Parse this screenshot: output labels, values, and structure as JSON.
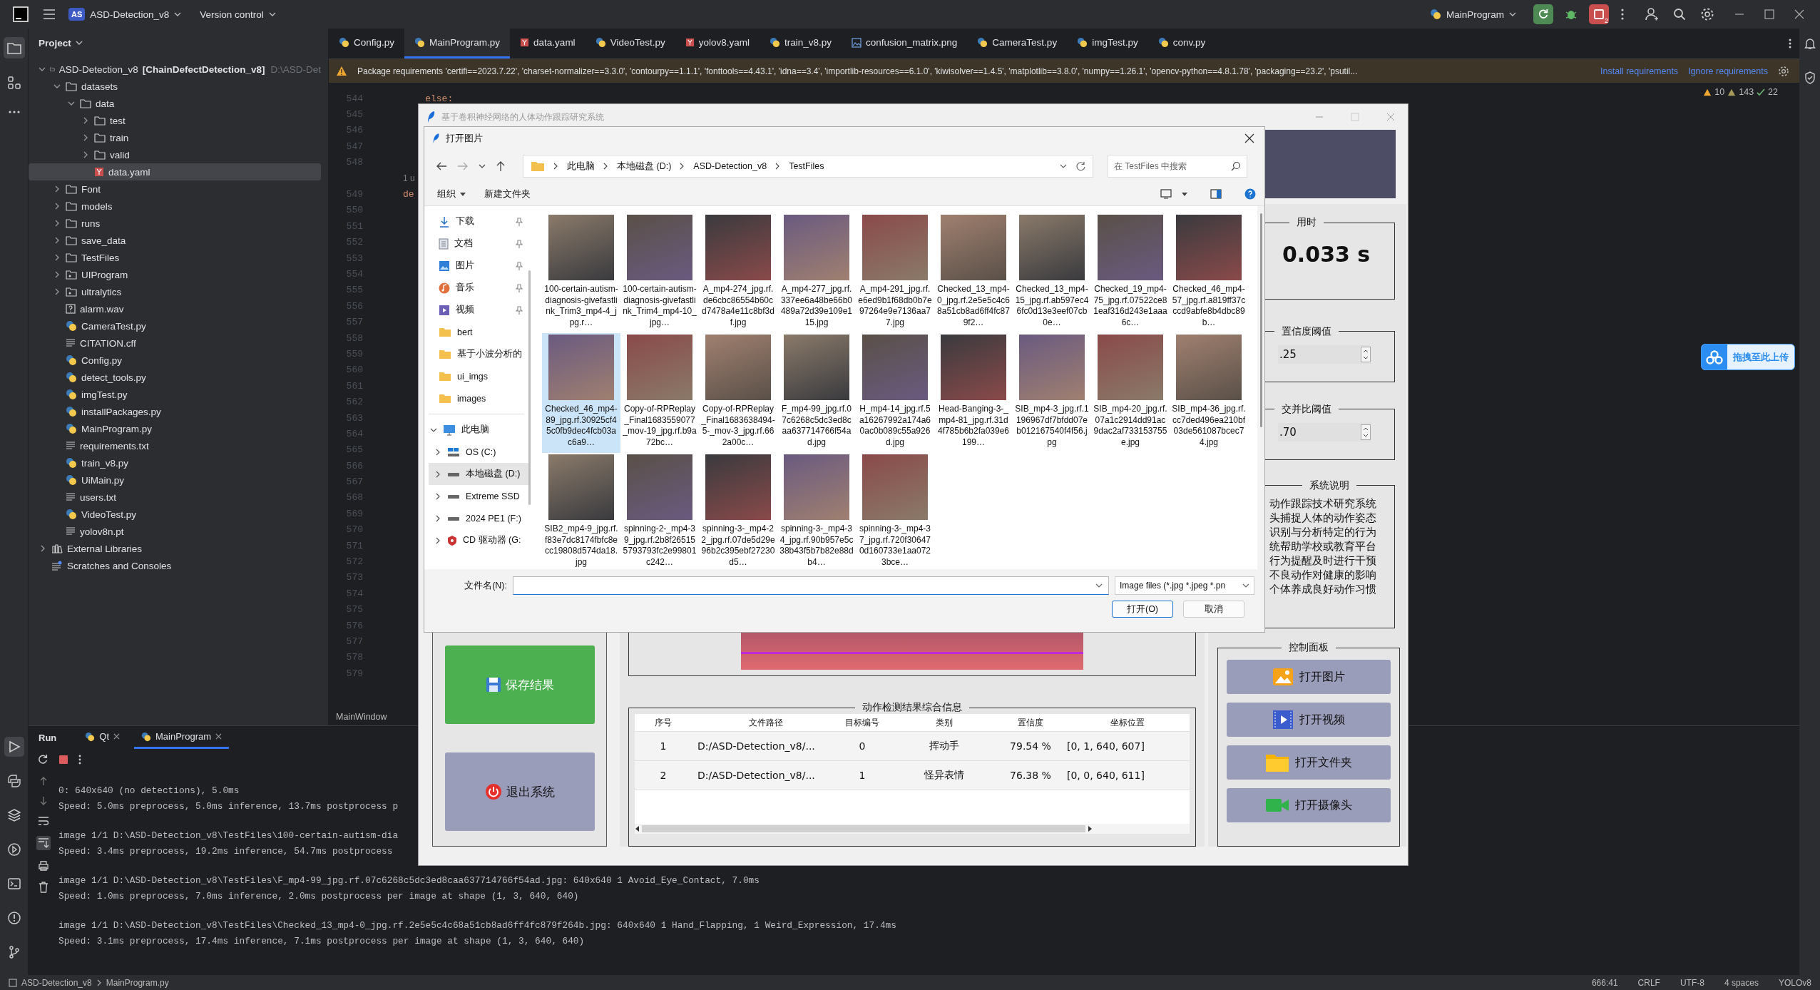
{
  "ide": {
    "project_badge": "AS",
    "project_name": "ASD-Detection_v8",
    "vcs": "Version control",
    "run_config": "MainProgram",
    "stop_badge": "2"
  },
  "project_panel": {
    "title": "Project",
    "tree": [
      {
        "label": "ASD-Detection_v8",
        "module": "[ChainDefectDetection_v8]",
        "path": "D:\\ASD-Det",
        "kind": "folder",
        "expanded": true,
        "selected": false,
        "children": [
          {
            "label": "datasets",
            "kind": "folder",
            "expanded": true,
            "selected": false,
            "children": [
              {
                "label": "data",
                "kind": "folder",
                "expanded": true,
                "selected": false,
                "children": [
                  {
                    "label": "test",
                    "kind": "folder",
                    "expanded": false,
                    "selected": false
                  },
                  {
                    "label": "train",
                    "kind": "folder",
                    "expanded": false,
                    "selected": false
                  },
                  {
                    "label": "valid",
                    "kind": "folder",
                    "expanded": false,
                    "selected": false
                  },
                  {
                    "label": "data.yaml",
                    "kind": "yaml",
                    "selected": true
                  }
                ]
              }
            ]
          },
          {
            "label": "Font",
            "kind": "folder",
            "expanded": false,
            "selected": false
          },
          {
            "label": "models",
            "kind": "folder",
            "expanded": false,
            "selected": false
          },
          {
            "label": "runs",
            "kind": "folder",
            "expanded": false,
            "selected": false
          },
          {
            "label": "save_data",
            "kind": "folder",
            "expanded": false,
            "selected": false
          },
          {
            "label": "TestFiles",
            "kind": "folder",
            "expanded": false,
            "selected": false
          },
          {
            "label": "UIProgram",
            "kind": "package",
            "expanded": false,
            "selected": false
          },
          {
            "label": "ultralytics",
            "kind": "package",
            "expanded": false,
            "selected": false
          },
          {
            "label": "alarm.wav",
            "kind": "unknown",
            "selected": false
          },
          {
            "label": "CameraTest.py",
            "kind": "python",
            "selected": false
          },
          {
            "label": "CITATION.cff",
            "kind": "text",
            "selected": false
          },
          {
            "label": "Config.py",
            "kind": "python",
            "selected": false
          },
          {
            "label": "detect_tools.py",
            "kind": "python",
            "selected": false
          },
          {
            "label": "imgTest.py",
            "kind": "python",
            "selected": false
          },
          {
            "label": "installPackages.py",
            "kind": "python",
            "selected": false
          },
          {
            "label": "MainProgram.py",
            "kind": "python",
            "selected": false
          },
          {
            "label": "requirements.txt",
            "kind": "text",
            "selected": false
          },
          {
            "label": "train_v8.py",
            "kind": "python",
            "selected": false
          },
          {
            "label": "UiMain.py",
            "kind": "python",
            "selected": false
          },
          {
            "label": "users.txt",
            "kind": "text",
            "selected": false
          },
          {
            "label": "VideoTest.py",
            "kind": "python",
            "selected": false
          },
          {
            "label": "yolov8n.pt",
            "kind": "text",
            "selected": false
          }
        ]
      },
      {
        "label": "External Libraries",
        "kind": "library",
        "expanded": false,
        "selected": false
      },
      {
        "label": "Scratches and Consoles",
        "kind": "scratch",
        "selected": false
      }
    ]
  },
  "editor": {
    "tabs": [
      {
        "label": "Config.py",
        "kind": "python",
        "selected": false
      },
      {
        "label": "MainProgram.py",
        "kind": "python",
        "selected": true
      },
      {
        "label": "data.yaml",
        "kind": "yaml",
        "selected": false
      },
      {
        "label": "VideoTest.py",
        "kind": "python",
        "selected": false
      },
      {
        "label": "yolov8.yaml",
        "kind": "yaml",
        "selected": false
      },
      {
        "label": "train_v8.py",
        "kind": "python",
        "selected": false
      },
      {
        "label": "confusion_matrix.png",
        "kind": "image",
        "selected": false
      },
      {
        "label": "CameraTest.py",
        "kind": "python",
        "selected": false
      },
      {
        "label": "imgTest.py",
        "kind": "python",
        "selected": false
      },
      {
        "label": "conv.py",
        "kind": "python",
        "selected": false
      }
    ],
    "banner": {
      "text": "Package requirements 'certifi==2023.7.22', 'charset-normalizer==3.3.0', 'contourpy==1.1.1', 'fonttools==4.43.1', 'idna==3.4', 'importlib-resources==6.1.0', 'kiwisolver==1.4.5', 'matplotlib==3.8.0', 'numpy==1.26.1', 'opencv-python==4.8.1.78', 'packaging==23.2', 'psutil...",
      "actions": [
        "Install requirements",
        "Ignore requirements"
      ]
    },
    "inspections": {
      "warnings": "10",
      "weak_warnings": "143",
      "passed": "22"
    },
    "lines": [
      {
        "number": "544",
        "text": "    else:"
      },
      {
        "number": "545"
      },
      {
        "number": "546"
      },
      {
        "number": "547"
      },
      {
        "number": "548"
      },
      {
        "number": "549",
        "hint": "1 u",
        "text": "de"
      },
      {
        "number": "550"
      },
      {
        "number": "551"
      },
      {
        "number": "552"
      },
      {
        "number": "553"
      },
      {
        "number": "554"
      },
      {
        "number": "555"
      },
      {
        "number": "556"
      },
      {
        "number": "557"
      },
      {
        "number": "558"
      },
      {
        "number": "559"
      },
      {
        "number": "560"
      },
      {
        "number": "561"
      },
      {
        "number": "562"
      },
      {
        "number": "563"
      },
      {
        "number": "564"
      },
      {
        "number": "565"
      },
      {
        "number": "566"
      },
      {
        "number": "567"
      },
      {
        "number": "568"
      },
      {
        "number": "569"
      },
      {
        "number": "570"
      },
      {
        "number": "571"
      },
      {
        "number": "572"
      },
      {
        "number": "573"
      },
      {
        "number": "574"
      },
      {
        "number": "575"
      },
      {
        "number": "576"
      },
      {
        "number": "577"
      },
      {
        "number": "578"
      },
      {
        "number": "579"
      }
    ],
    "breadcrumb": "MainWindow"
  },
  "run_panel": {
    "title": "Run",
    "tabs": [
      {
        "label": "Qt",
        "selected": false
      },
      {
        "label": "MainProgram",
        "selected": true
      }
    ],
    "console": [
      [
        "0: 640x640 (no detections), 5.0ms",
        "Speed: 5.0ms preprocess, 5.0ms inference, 13.7ms postprocess p"
      ],
      [
        "image 1/1 D:\\ASD-Detection_v8\\TestFiles\\100-certain-autism-dia",
        "Speed: 3.4ms preprocess, 19.2ms inference, 54.7ms postprocess"
      ],
      [
        "image 1/1 D:\\ASD-Detection_v8\\TestFiles\\F_mp4-99_jpg.rf.07c6268c5dc3ed8caa637714766f54ad.jpg: 640x640 1 Avoid_Eye_Contact, 7.0ms",
        "Speed: 1.0ms preprocess, 7.0ms inference, 2.0ms postprocess per image at shape (1, 3, 640, 640)"
      ],
      [
        "image 1/1 D:\\ASD-Detection_v8\\TestFiles\\Checked_13_mp4-0_jpg.rf.2e5e5c4c68a51cb8ad6ff4fc879f264b.jpg: 640x640 1 Hand_Flapping, 1 Weird_Expression, 17.4ms",
        "Speed: 3.1ms preprocess, 17.4ms inference, 7.1ms postprocess per image at shape (1, 3, 640, 640)"
      ]
    ]
  },
  "status_bar": {
    "path": [
      "ASD-Detection_v8",
      "MainProgram.py"
    ],
    "items": [
      "666:41",
      "CRLF",
      "UTF-8",
      "4 spaces",
      "YOLOv8"
    ]
  },
  "app_window": {
    "title": "基于卷积神经网络的人体动作跟踪研究系统",
    "left_buttons": [
      {
        "label": "保存结果",
        "kind": "save"
      },
      {
        "label": "退出系统",
        "kind": "exit"
      }
    ],
    "results": {
      "title": "动作检测结果综合信息",
      "columns": [
        "序号",
        "文件路径",
        "目标编号",
        "类别",
        "置信度",
        "坐标位置"
      ],
      "rows": [
        [
          "1",
          "D:/ASD-Detection_v8/...",
          "0",
          "挥动手",
          "79.54 %",
          "[0, 1, 640, 607]"
        ],
        [
          "2",
          "D:/ASD-Detection_v8/...",
          "1",
          "怪异表情",
          "76.38 %",
          "[0, 0, 640, 611]"
        ]
      ]
    },
    "time": {
      "title": "用时",
      "value": "0.033 s"
    },
    "confidence": {
      "title": "置信度阈值",
      "value": ".25"
    },
    "iou": {
      "title": "交并比阈值",
      "value": ".70"
    },
    "description": {
      "title": "系统说明",
      "lines": [
        "动作跟踪技术研究系统",
        "头捕捉人体的动作姿态",
        "识别与分析特定的行为",
        "统帮助学校或教育平台",
        "行为提醒及时进行干预",
        "不良动作对健康的影响",
        "个体养成良好动作习惯"
      ]
    },
    "controls": {
      "title": "控制面板",
      "buttons": [
        {
          "label": "打开图片",
          "kind": "image"
        },
        {
          "label": "打开视频",
          "kind": "video"
        },
        {
          "label": "打开文件夹",
          "kind": "folder"
        },
        {
          "label": "打开摄像头",
          "kind": "camera"
        }
      ]
    }
  },
  "dialog": {
    "title": "打开图片",
    "breadcrumbs": [
      "此电脑",
      "本地磁盘 (D:)",
      "ASD-Detection_v8",
      "TestFiles"
    ],
    "search": {
      "placeholder": "在 TestFiles 中搜索"
    },
    "toolbar": {
      "organize": "组织",
      "new_folder": "新建文件夹"
    },
    "nav": {
      "quick": [
        {
          "label": "下载",
          "kind": "download",
          "pinned": true,
          "selected": false
        },
        {
          "label": "文档",
          "kind": "document",
          "pinned": true,
          "selected": false
        },
        {
          "label": "图片",
          "kind": "pictures",
          "pinned": true,
          "selected": false
        },
        {
          "label": "音乐",
          "kind": "music",
          "pinned": true,
          "selected": false
        },
        {
          "label": "视频",
          "kind": "videos",
          "pinned": true,
          "selected": false
        },
        {
          "label": "bert",
          "kind": "folder",
          "pinned": false,
          "selected": false
        },
        {
          "label": "基于小波分析的",
          "kind": "folder",
          "pinned": false,
          "selected": false
        },
        {
          "label": "ui_imgs",
          "kind": "folder",
          "pinned": false,
          "selected": false
        },
        {
          "label": "images",
          "kind": "folder",
          "pinned": false,
          "selected": false
        }
      ],
      "pc": {
        "label": "此电脑",
        "expanded": true,
        "selected": false,
        "children": [
          {
            "label": "OS (C:)",
            "kind": "system",
            "expanded": false,
            "selected": false
          },
          {
            "label": "本地磁盘 (D:)",
            "kind": "drive",
            "expanded": false,
            "selected": true
          },
          {
            "label": "Extreme SSD",
            "kind": "drive",
            "expanded": false,
            "selected": false
          },
          {
            "label": "2024 PE1 (F:)",
            "kind": "drive",
            "expanded": false,
            "selected": false
          },
          {
            "label": "CD 驱动器 (G:",
            "kind": "cd",
            "expanded": false,
            "selected": false
          }
        ]
      }
    },
    "files": [
      {
        "name": "100-certain-autism-diagnosis-givefastlink_Trim3_mp4-4_jpg.r…",
        "selected": false
      },
      {
        "name": "100-certain-autism-diagnosis-givefastlink_Trim4_mp4-10_jpg…",
        "selected": false
      },
      {
        "name": "A_mp4-274_jpg.rf.de6cbc86554b60cd7478a4e11c8bf3df.jpg",
        "selected": false
      },
      {
        "name": "A_mp4-277_jpg.rf.337ee6a48be66b0489a72d39e109e115.jpg",
        "selected": false
      },
      {
        "name": "A_mp4-291_jpg.rf.e6ed9b1f68db0b7e97264e9e7136aa77.jpg",
        "selected": false
      },
      {
        "name": "Checked_13_mp4-0_jpg.rf.2e5e5c4c68a51cb8ad6ff4fc879f2…",
        "selected": false
      },
      {
        "name": "Checked_13_mp4-15_jpg.rf.ab597ec46fc0d13e3eef07cb0e…",
        "selected": false
      },
      {
        "name": "Checked_19_mp4-75_jpg.rf.07522ce81eaf316d243e1aaa6c…",
        "selected": false
      },
      {
        "name": "Checked_46_mp4-57_jpg.rf.a819ff37cccd9abfe8b4dbc89b…",
        "selected": false
      },
      {
        "name": "Checked_46_mp4-89_jpg.rf.30925cf45c0fb9dec4fcb03ac6a9…",
        "selected": true
      },
      {
        "name": "Copy-of-RPReplay_Final1683559077_mov-19_jpg.rf.b9a72bc…",
        "selected": false
      },
      {
        "name": "Copy-of-RPReplay_Final1683638494-5-_mov-3_jpg.rf.662a00c…",
        "selected": false
      },
      {
        "name": "F_mp4-99_jpg.rf.07c6268c5dc3ed8caa637714766f54ad.jpg",
        "selected": false
      },
      {
        "name": "H_mp4-14_jpg.rf.5a16267992a174a60ac0b089c55a926d.jpg",
        "selected": false
      },
      {
        "name": "Head-Banging-3-_mp4-81_jpg.rf.31d4f785b6b2fa039e6199…",
        "selected": false
      },
      {
        "name": "SIB_mp4-3_jpg.rf.1196967df7bfdd07eb012167540f4f56.jpg",
        "selected": false
      },
      {
        "name": "SIB_mp4-20_jpg.rf.07a1c2914dd91ac9dac2af733153755e.jpg",
        "selected": false
      },
      {
        "name": "SIB_mp4-36_jpg.rf.cc7ded496ea210bf03de561087bcec74.jpg",
        "selected": false
      },
      {
        "name": "SIB2_mp4-9_jpg.rf.f83e7dc8174fbfc8ecc19808d574da18.jpg",
        "selected": false
      },
      {
        "name": "spinning-2-_mp4-39_jpg.rf.2b8f265155793793fc2e99801c242…",
        "selected": false
      },
      {
        "name": "spinning-3-_mp4-22_jpg.rf.07de5d29e96b2c395ebf27230d5…",
        "selected": false
      },
      {
        "name": "spinning-3-_mp4-34_jpg.rf.90b957e5c38b43f5b7b82e88db4…",
        "selected": false
      },
      {
        "name": "spinning-3-_mp4-37_jpg.rf.720f306470d160733e1aa0723bce…",
        "selected": false
      }
    ],
    "filename": {
      "label": "文件名(N):"
    },
    "filetype": "Image files (*.jpg *.jpeg *.pn",
    "buttons": [
      {
        "label": "打开(O)",
        "kind": "primary"
      },
      {
        "label": "取消",
        "kind": "secondary"
      }
    ]
  },
  "upload_badge": {
    "label": "拖拽至此上传"
  }
}
